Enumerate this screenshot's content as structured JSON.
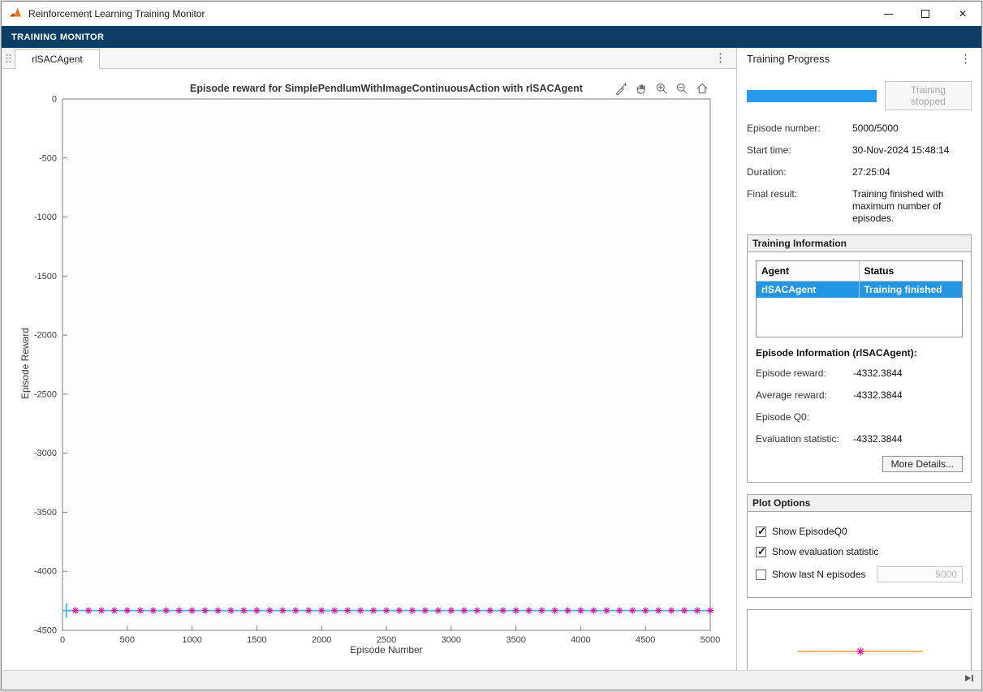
{
  "window": {
    "title": "Reinforcement Learning Training Monitor"
  },
  "ribbon": {
    "tab_label": "TRAINING MONITOR"
  },
  "document": {
    "tab_label": "rlSACAgent"
  },
  "chart_data": {
    "type": "line",
    "title": "Episode reward for SimplePendlumWithImageContinuousAction with rlSACAgent",
    "xlabel": "Episode Number",
    "ylabel": "Episode Reward",
    "xlim": [
      0,
      5000
    ],
    "ylim": [
      -4500,
      0
    ],
    "xticks": [
      0,
      500,
      1000,
      1500,
      2000,
      2500,
      3000,
      3500,
      4000,
      4500,
      5000
    ],
    "yticks": [
      0,
      -500,
      -1000,
      -1500,
      -2000,
      -2500,
      -3000,
      -3500,
      -4000,
      -4500
    ],
    "grid": false,
    "series": [
      {
        "name": "Episode reward",
        "type": "line",
        "color": "#4DBEEE",
        "y_constant": -4332.3844,
        "x_range": [
          0,
          5000
        ]
      },
      {
        "name": "Evaluation statistic",
        "type": "markers",
        "marker": "asterisk",
        "color": "#EE10A0",
        "y_constant": -4332.3844,
        "x_start": 100,
        "x_step": 100,
        "x_end": 5000
      }
    ]
  },
  "training_progress": {
    "header": "Training Progress",
    "progress_percent": 100,
    "progress_color": "#2499EF",
    "stop_button_label": "Training stopped",
    "fields": [
      {
        "label": "Episode number:",
        "value": "5000/5000"
      },
      {
        "label": "Start time:",
        "value": "30-Nov-2024 15:48:14"
      },
      {
        "label": "Duration:",
        "value": "27:25:04"
      },
      {
        "label": "Final result:",
        "value": "Training finished with maximum number of episodes."
      }
    ]
  },
  "training_information": {
    "header": "Training Information",
    "table": {
      "columns": [
        "Agent",
        "Status"
      ],
      "rows": [
        {
          "agent": "rlSACAgent",
          "status": "Training finished",
          "selected": true
        }
      ],
      "selection_color": "#2196E3"
    },
    "episode_info_header": "Episode Information (rlSACAgent):",
    "fields": [
      {
        "label": "Episode reward:",
        "value": "-4332.3844"
      },
      {
        "label": "Average reward:",
        "value": "-4332.3844"
      },
      {
        "label": "Episode Q0:",
        "value": ""
      },
      {
        "label": "Evaluation statistic:",
        "value": "-4332.3844"
      }
    ],
    "more_details_label": "More Details..."
  },
  "plot_options": {
    "header": "Plot Options",
    "options": [
      {
        "label": "Show EpisodeQ0",
        "checked": true
      },
      {
        "label": "Show evaluation statistic",
        "checked": true
      },
      {
        "label": "Show last N episodes",
        "checked": false
      }
    ],
    "last_n_value": "5000"
  },
  "legend_preview": {
    "line_color": "#F0A030",
    "marker_color": "#EE10A0"
  }
}
